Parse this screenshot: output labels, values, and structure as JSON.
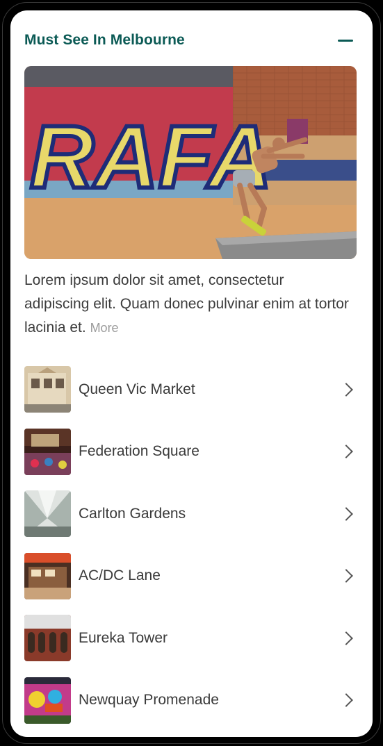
{
  "section": {
    "title": "Must See In Melbourne",
    "collapse_icon": "minus-icon"
  },
  "hero": {
    "graffiti_text": "RAFA",
    "description": "Lorem ipsum dolor sit amet, consectetur adipiscing elit. Quam donec pulvinar enim at tortor lacinia et.",
    "more_label": "More"
  },
  "places": [
    {
      "name": "Queen Vic Market",
      "icon": "chevron-right-icon"
    },
    {
      "name": "Federation Square",
      "icon": "chevron-right-icon"
    },
    {
      "name": "Carlton Gardens",
      "icon": "chevron-right-icon"
    },
    {
      "name": "AC/DC Lane",
      "icon": "chevron-right-icon"
    },
    {
      "name": "Eureka Tower",
      "icon": "chevron-right-icon"
    },
    {
      "name": "Newquay Promenade",
      "icon": "chevron-right-icon"
    }
  ],
  "colors": {
    "accent": "#0b5a55",
    "text": "#3a3a3a",
    "muted": "#9a9a9a"
  }
}
